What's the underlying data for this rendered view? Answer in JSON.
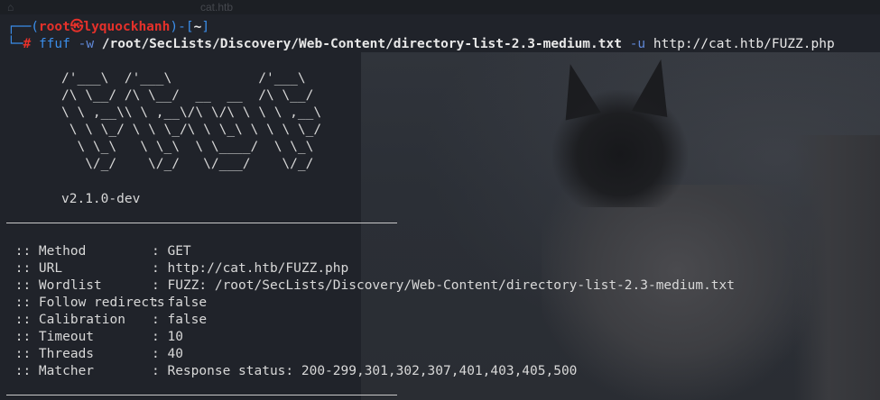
{
  "tabs": {
    "ghost_tab": "cat.htb"
  },
  "prompt": {
    "open": "┌──(",
    "user": "root",
    "at": "㉿",
    "host": "lyquockhanh",
    "close": ")-[",
    "dir": "~",
    "end": "]",
    "line2_prefix": "└─",
    "hash": "#",
    "cmd": "ffuf",
    "flag_w": "-w",
    "wordlist": "/root/SecLists/Discovery/Web-Content/directory-list-2.3-medium.txt",
    "flag_u": "-u",
    "url": "http://cat.htb/FUZZ.php"
  },
  "banner": {
    "ascii": "/'___\\  /'___\\           /'___\\\n/\\ \\__/ /\\ \\__/  __  __  /\\ \\__/\n\\ \\ ,__\\\\ \\ ,__\\/\\ \\/\\ \\ \\ \\ ,__\\\n \\ \\ \\_/ \\ \\ \\_/\\ \\ \\_\\ \\ \\ \\ \\_/\n  \\ \\_\\   \\ \\_\\  \\ \\____/  \\ \\_\\\n   \\/_/    \\/_/   \\/___/    \\/_/",
    "version": "v2.1.0-dev"
  },
  "config": [
    {
      "label": " :: Method",
      "value": ": GET"
    },
    {
      "label": " :: URL",
      "value": ": http://cat.htb/FUZZ.php"
    },
    {
      "label": " :: Wordlist",
      "value": ": FUZZ: /root/SecLists/Discovery/Web-Content/directory-list-2.3-medium.txt"
    },
    {
      "label": " :: Follow redirects",
      "value": ": false"
    },
    {
      "label": " :: Calibration",
      "value": ": false"
    },
    {
      "label": " :: Timeout",
      "value": ": 10"
    },
    {
      "label": " :: Threads",
      "value": ": 40"
    },
    {
      "label": " :: Matcher",
      "value": ": Response status: 200-299,301,302,307,401,403,405,500"
    }
  ],
  "colors": {
    "prompt_frame": "#3b8eea",
    "prompt_user": "#e5312a",
    "text": "#d8d8d8",
    "background": "#20232a"
  }
}
